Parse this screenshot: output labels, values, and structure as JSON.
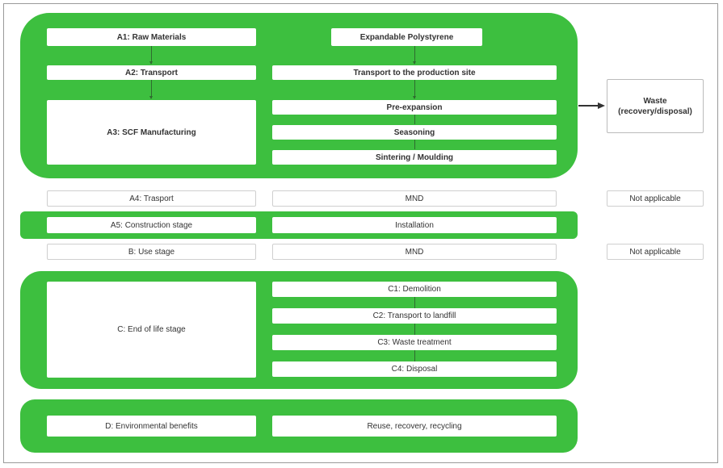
{
  "colors": {
    "group_green": "#3dbf3f",
    "box_fill": "#ffffff",
    "text": "#333333",
    "arrow": "#333333"
  },
  "production": {
    "a1": "A1: Raw Materials",
    "a2": "A2: Transport",
    "a3": "A3: SCF Manufacturing",
    "eps": "Expandable Polystyrene",
    "transport_site": "Transport to the production site",
    "pre_expansion": "Pre-expansion",
    "seasoning": "Seasoning",
    "sintering": "Sintering / Moulding"
  },
  "waste": {
    "line1": "Waste",
    "line2": "(recovery/disposal)"
  },
  "a4": {
    "label": "A4: Trasport",
    "value": "MND",
    "note": "Not applicable"
  },
  "a5": {
    "label": "A5: Construction stage",
    "value": "Installation"
  },
  "b": {
    "label": "B: Use stage",
    "value": "MND",
    "note": "Not applicable"
  },
  "c": {
    "label": "C: End of life stage",
    "c1": "C1: Demolition",
    "c2": "C2: Transport to landfill",
    "c3": "C3: Waste treatment",
    "c4": "C4: Disposal"
  },
  "d": {
    "label": "D: Environmental benefits",
    "value": "Reuse, recovery, recycling"
  }
}
